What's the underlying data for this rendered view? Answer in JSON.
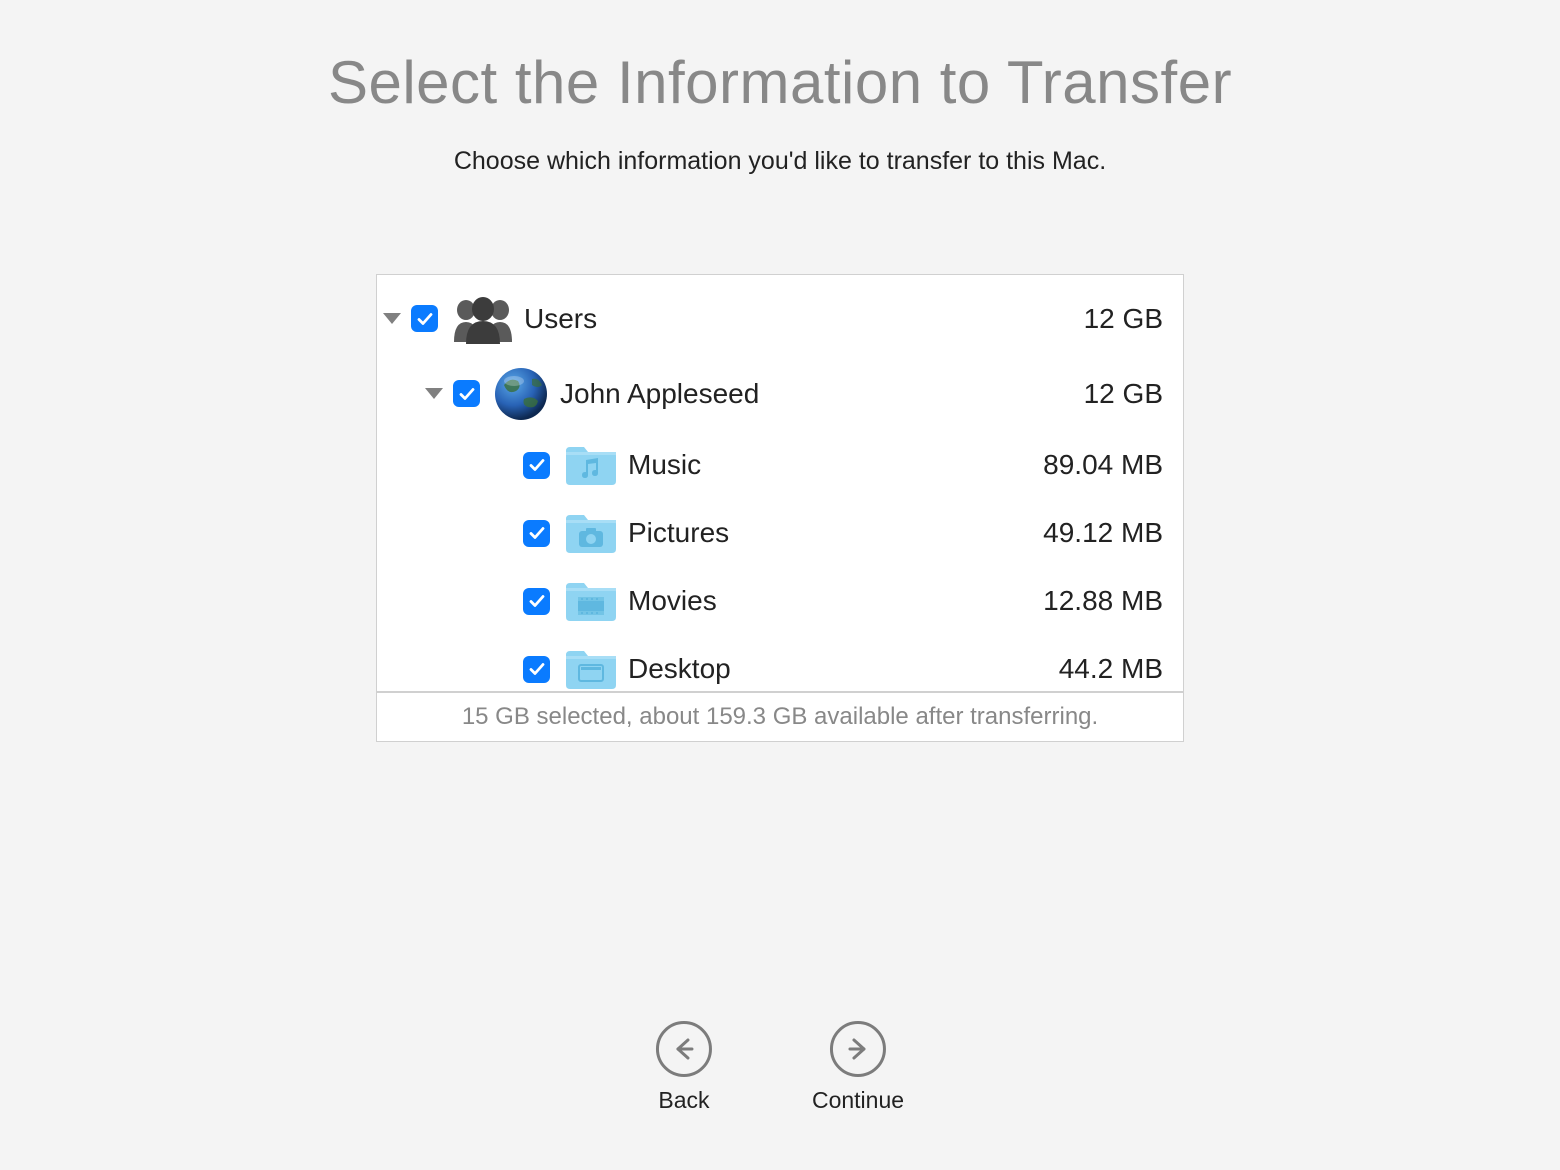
{
  "title": "Select the Information to Transfer",
  "subtitle": "Choose which information you'd like to transfer to this Mac.",
  "tree": {
    "users": {
      "label": "Users",
      "size": "12 GB",
      "checked": true,
      "expanded": true
    },
    "user": {
      "label": "John Appleseed",
      "size": "12 GB",
      "checked": true,
      "expanded": true
    },
    "folders": [
      {
        "label": "Music",
        "size": "89.04 MB",
        "checked": true,
        "icon": "music"
      },
      {
        "label": "Pictures",
        "size": "49.12 MB",
        "checked": true,
        "icon": "pictures"
      },
      {
        "label": "Movies",
        "size": "12.88 MB",
        "checked": true,
        "icon": "movies"
      },
      {
        "label": "Desktop",
        "size": "44.2 MB",
        "checked": true,
        "icon": "desktop"
      }
    ]
  },
  "footer": "15 GB selected, about 159.3 GB available after transferring.",
  "nav": {
    "back": "Back",
    "continue": "Continue"
  }
}
